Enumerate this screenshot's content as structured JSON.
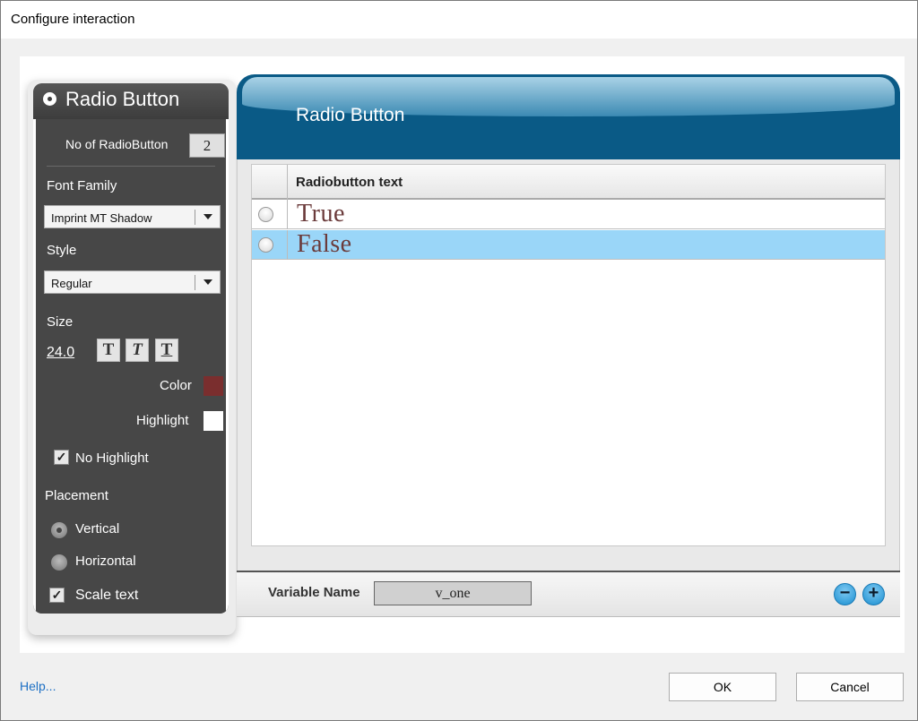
{
  "window": {
    "title": "Configure interaction"
  },
  "settings_panel": {
    "title": "Radio Button",
    "count_label": "No of RadioButton",
    "count_value": "2",
    "font_family_label": "Font Family",
    "font_family_value": "Imprint MT Shadow",
    "style_label": "Style",
    "style_value": "Regular",
    "size_label": "Size",
    "size_value": "24.0",
    "format_buttons": [
      "T",
      "T",
      "T"
    ],
    "color_label": "Color",
    "color_value": "#8b2a2a",
    "highlight_label": "Highlight",
    "highlight_value": "#ffffff",
    "no_highlight_label": "No Highlight",
    "no_highlight_checked": true,
    "placement_label": "Placement",
    "placement_options": [
      "Vertical",
      "Horizontal"
    ],
    "placement_selected": "Vertical",
    "scale_text_label": "Scale text",
    "scale_text_checked": true
  },
  "preview": {
    "title": "Radio Button",
    "table_header": "Radiobutton text",
    "rows": [
      {
        "text": "True",
        "highlighted": false
      },
      {
        "text": "False",
        "highlighted": true
      }
    ],
    "variable_label": "Variable Name",
    "variable_value": "v_one",
    "minus_label": "−",
    "plus_label": "+"
  },
  "footer": {
    "help_label": "Help...",
    "ok_label": "OK",
    "cancel_label": "Cancel"
  },
  "colors": {
    "header_blue": "#0a5a86",
    "row_highlight": "#9ad6f8",
    "panel_dark": "#474747"
  }
}
